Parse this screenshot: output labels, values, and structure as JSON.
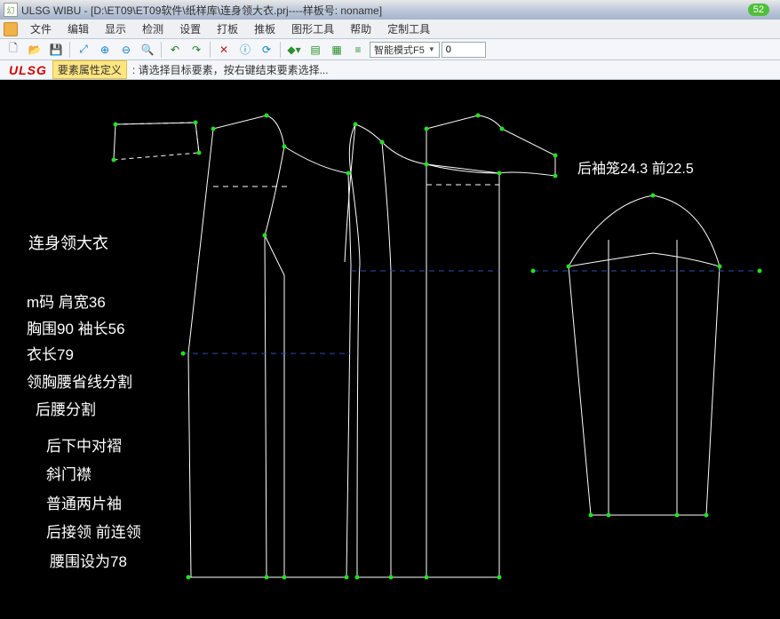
{
  "window": {
    "title": "ULSG WIBU - [D:\\ET09\\ET09软件\\纸样库\\连身领大衣.prj----样板号: noname]",
    "badge": "52"
  },
  "menu": {
    "file": "文件",
    "edit": "编辑",
    "view": "显示",
    "inspect": "检测",
    "settings": "设置",
    "layout": "打板",
    "push": "推板",
    "graphic_tools": "图形工具",
    "help": "帮助",
    "custom_tools": "定制工具"
  },
  "toolbar": {
    "combo_mode": "智能模式F5",
    "num_value": "0"
  },
  "status": {
    "logo": "ULSG",
    "mode": "要素属性定义",
    "message": ": 请选择目标要素，按右键结束要素选择..."
  },
  "canvas_text": {
    "title": "连身领大衣",
    "size_line": "m码  肩宽36",
    "bust_sleeve": "胸围90  袖长56",
    "length": "衣长79",
    "split1": "领胸腰省线分割",
    "split2": "后腰分割",
    "pleat": "后下中对褶",
    "placket": "斜门襟",
    "sleeve_type": "普通两片袖",
    "collar": "后接领  前连领",
    "waist": "腰围设为78",
    "armhole": "后袖笼24.3   前22.5"
  },
  "chart_data": {
    "type": "diagram",
    "description": "garment pattern pieces",
    "measurements": {
      "size": "m",
      "shoulder_width": 36,
      "bust": 90,
      "sleeve_length": 56,
      "garment_length": 79,
      "waist_design": 78,
      "back_armhole": 24.3,
      "front_armhole": 22.5
    }
  }
}
